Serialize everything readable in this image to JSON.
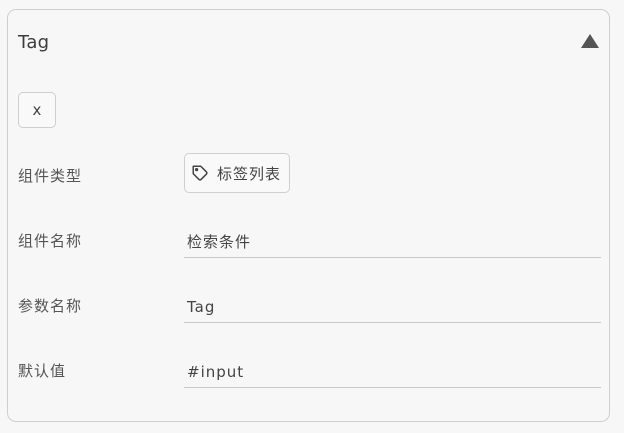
{
  "panel": {
    "title": "Tag",
    "collapse_icon": "triangle-up-icon",
    "close_label": "x"
  },
  "fields": {
    "component_type": {
      "label": "组件类型",
      "value": "标签列表",
      "icon": "tag-icon"
    },
    "component_name": {
      "label": "组件名称",
      "value": "检索条件"
    },
    "param_name": {
      "label": "参数名称",
      "value": "Tag"
    },
    "default_value": {
      "label": "默认值",
      "value": "#input"
    }
  },
  "colors": {
    "background": "#f7f7f7",
    "border": "#cfcfcf",
    "text": "#444444",
    "label": "#555555"
  }
}
